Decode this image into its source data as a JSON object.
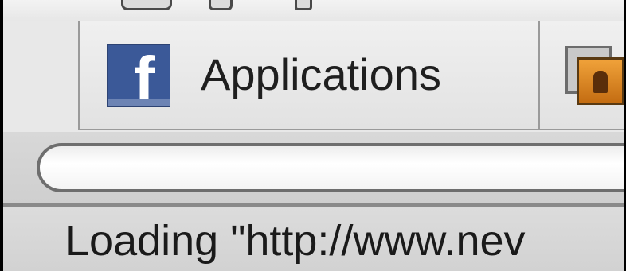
{
  "bookmarks_bar": {
    "items": [
      {
        "label": "Applications",
        "icon": "facebook-icon"
      },
      {
        "label": "",
        "icon": "folder-icon"
      }
    ]
  },
  "address_bar": {
    "value": ""
  },
  "status_bar": {
    "text": "Loading \"http://www.nev"
  },
  "colors": {
    "facebook_blue": "#3b5998",
    "chrome_gray": "#e8e8e8",
    "frame_black": "#000000"
  }
}
